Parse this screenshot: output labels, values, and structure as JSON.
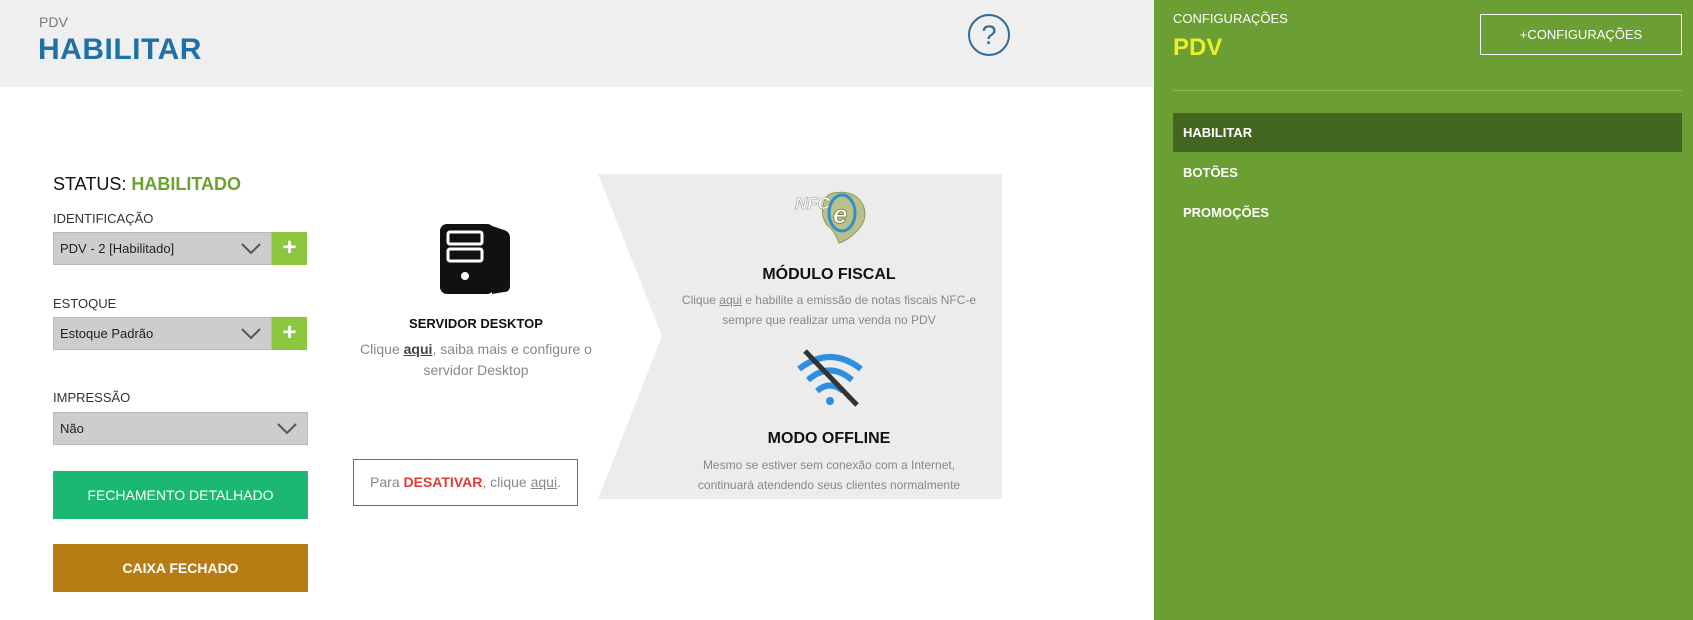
{
  "header": {
    "breadcrumb": "PDV",
    "title": "HABILITAR",
    "help_symbol": "?"
  },
  "status": {
    "label": "STATUS: ",
    "value": "HABILITADO"
  },
  "form": {
    "identificacao": {
      "label": "IDENTIFICAÇÃO",
      "value": "PDV - 2 [Habilitado]"
    },
    "estoque": {
      "label": "ESTOQUE",
      "value": "Estoque Padrão"
    },
    "impressao": {
      "label": "IMPRESSÃO",
      "value": "Não"
    },
    "add_symbol": "+"
  },
  "buttons": {
    "fechamento": "FECHAMENTO DETALHADO",
    "caixa": "CAIXA FECHADO"
  },
  "server": {
    "icon": "desktop-server-icon",
    "title": "SERVIDOR DESKTOP",
    "text_pre": "Clique ",
    "link": "aqui",
    "text_post": ", saiba mais e configure o servidor Desktop"
  },
  "deactivate": {
    "pre": "Para ",
    "action": "DESATIVAR",
    "mid": ", clique ",
    "link": "aqui",
    "post": "."
  },
  "fiscal": {
    "icon": "nfce-logo-icon",
    "logo_text": "NFC",
    "logo_letter": "e",
    "title": "MÓDULO FISCAL",
    "text_pre": "Clique ",
    "link": "aqui",
    "text_post": " e habilite a emissão de notas fiscais NFC-e sempre que realizar uma venda no PDV"
  },
  "offline": {
    "icon": "wifi-off-icon",
    "title": "MODO OFFLINE",
    "text": "Mesmo se estiver sem conexão com a Internet, continuará atendendo seus clientes normalmente"
  },
  "sidebar": {
    "subtitle": "CONFIGURAÇÕES",
    "title": "PDV",
    "config_button": "+CONFIGURAÇÕES",
    "items": [
      {
        "label": "HABILITAR",
        "active": true
      },
      {
        "label": "BOTÕES",
        "active": false
      },
      {
        "label": "PROMOÇÕES",
        "active": false
      }
    ]
  },
  "colors": {
    "sidebar_bg": "#6b9e33",
    "sidebar_active": "#42651f",
    "title_blue": "#1c72a8",
    "status_green": "#6ca12f",
    "plus_green": "#8dc63f",
    "fechamento_green": "#1ab872",
    "caixa_brown": "#b87c14",
    "danger_red": "#e53935"
  }
}
